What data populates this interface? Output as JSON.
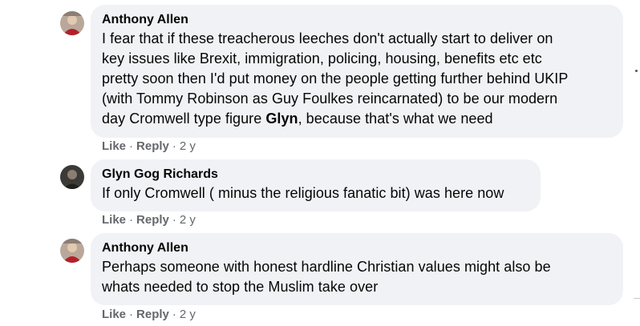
{
  "comments": [
    {
      "author": "Anthony Allen",
      "text_lines": [
        "I fear that if these treacherous leeches don't actually start to deliver on",
        "key issues like Brexit, immigration, policing, housing, benefits etc etc",
        "pretty soon then I'd put money on the people getting further behind UKIP",
        "(with Tommy Robinson as Guy Foulkes reincarnated) to be our modern"
      ],
      "last_line_prefix": "day Cromwell type figure ",
      "mention": "Glyn",
      "last_line_suffix": ", because that's what we need",
      "like_label": "Like",
      "reply_label": "Reply",
      "time": "2 y",
      "avatar_icon": "profile-photo"
    },
    {
      "author": "Glyn Gog Richards",
      "text_lines": [
        "If only Cromwell ( minus the religious fanatic bit) was here now"
      ],
      "like_label": "Like",
      "reply_label": "Reply",
      "time": "2 y",
      "avatar_icon": "profile-photo"
    },
    {
      "author": "Anthony Allen",
      "text_lines": [
        "Perhaps someone with honest hardline Christian values might also be",
        "whats needed to stop the Muslim take over"
      ],
      "like_label": "Like",
      "reply_label": "Reply",
      "time": "2 y",
      "avatar_icon": "profile-photo"
    }
  ],
  "separator": "·",
  "colors": {
    "bubble": "#f0f2f5",
    "text": "#050505",
    "meta": "#65676b"
  }
}
